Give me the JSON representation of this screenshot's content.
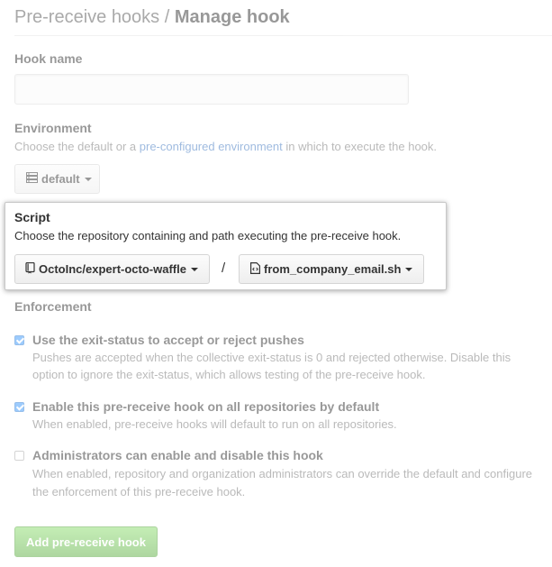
{
  "header": {
    "breadcrumb_parent": "Pre-receive hooks",
    "separator": " / ",
    "title": "Manage hook"
  },
  "hook_name": {
    "label": "Hook name",
    "value": ""
  },
  "environment": {
    "label": "Environment",
    "note_before": "Choose the default or a ",
    "note_link": "pre-configured environment",
    "note_after": " in which to execute the hook.",
    "selected": "default",
    "icon": "server-icon"
  },
  "script": {
    "label": "Script",
    "note": "Choose the repository containing and path executing the pre-receive hook.",
    "repository": "OctoInc/expert-octo-waffle",
    "repository_icon": "repo-icon",
    "separator": "/",
    "file": "from_company_email.sh",
    "file_icon": "code-file-icon"
  },
  "enforcement": {
    "label": "Enforcement",
    "options": [
      {
        "label": "Use the exit-status to accept or reject pushes",
        "desc_line1": "Pushes are accepted when the collective exit-status is 0 and rejected otherwise. Disable this",
        "desc_line2": "option to ignore the exit-status, which allows testing of the pre-receive hook.",
        "checked": true
      },
      {
        "label": "Enable this pre-receive hook on all repositories by default",
        "desc_line1": "When enabled, pre-receive hooks will default to run on all repositories.",
        "desc_line2": "",
        "checked": true
      },
      {
        "label": "Administrators can enable and disable this hook",
        "desc_line1": "When enabled, repository and organization administrators can override the default and configure",
        "desc_line2": "the enforcement of this pre-receive hook.",
        "checked": false
      }
    ]
  },
  "actions": {
    "submit_label": "Add pre-receive hook"
  },
  "colors": {
    "link": "#4078c0",
    "checkbox_checked": "#3b99fc",
    "submit_green": "#60b044"
  }
}
